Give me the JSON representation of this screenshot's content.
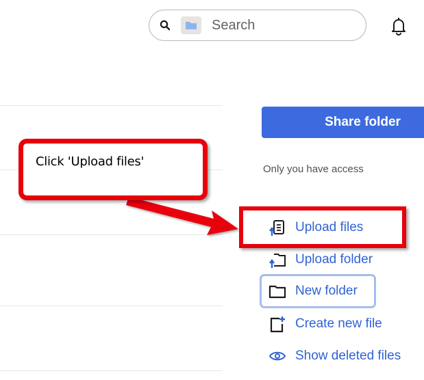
{
  "search": {
    "placeholder": "Search"
  },
  "sidebar": {
    "share_label": "Share folder",
    "access_text": "Only you have access",
    "actions": [
      {
        "label": "Upload files",
        "icon": "upload-file-icon"
      },
      {
        "label": "Upload folder",
        "icon": "upload-folder-icon"
      },
      {
        "label": "New folder",
        "icon": "folder-icon"
      },
      {
        "label": "Create new file",
        "icon": "new-file-icon"
      },
      {
        "label": "Show deleted files",
        "icon": "eye-icon"
      }
    ]
  },
  "annotation": {
    "callout_text": "Click 'Upload files'"
  },
  "colors": {
    "accent": "#3d6ade",
    "link": "#2f62d6",
    "annotation_red": "#e8000b"
  }
}
